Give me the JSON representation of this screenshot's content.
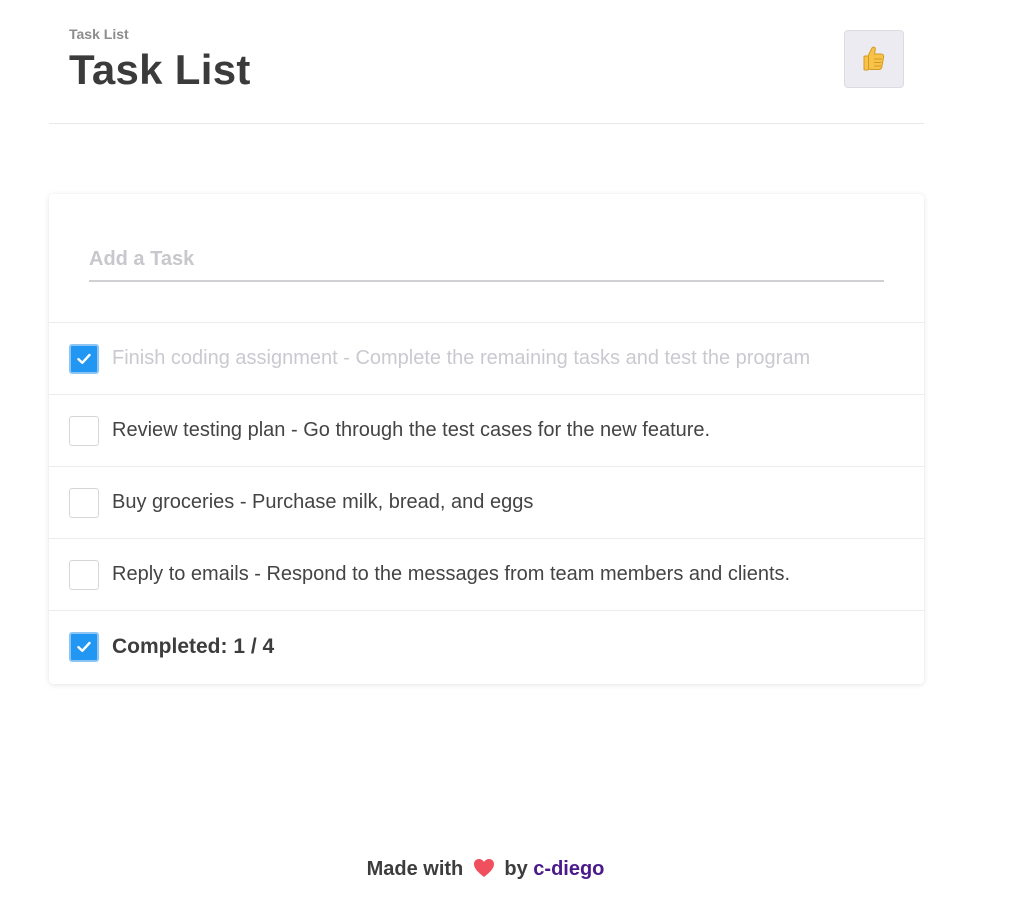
{
  "header": {
    "subtitle": "Task List",
    "title": "Task List",
    "thumb_icon": "thumbs-up-icon"
  },
  "add_task": {
    "placeholder": "Add a Task",
    "value": ""
  },
  "tasks": [
    {
      "text": "Finish coding assignment - Complete the remaining tasks and test the program",
      "completed": true
    },
    {
      "text": "Review testing plan - Go through the test cases for the new feature.",
      "completed": false
    },
    {
      "text": "Buy groceries - Purchase milk, bread, and eggs",
      "completed": false
    },
    {
      "text": "Reply to emails - Respond to the messages from team members and clients.",
      "completed": false
    }
  ],
  "summary": {
    "label": "Completed: 1 / 4",
    "checked": true
  },
  "footer": {
    "made_with": "Made with",
    "heart_icon": "heart-icon",
    "by": "by",
    "author": "c-diego"
  },
  "colors": {
    "accent": "#2196f3",
    "author_link": "#4a1a8c",
    "completed_text": "#c9c9d0"
  }
}
